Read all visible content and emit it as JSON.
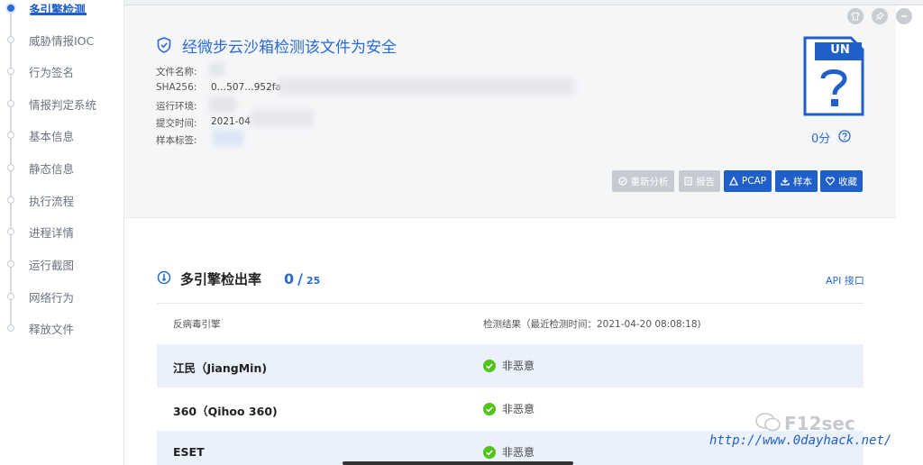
{
  "sidebar": {
    "items": [
      {
        "label": "多引擎检测",
        "active": true
      },
      {
        "label": "威胁情报IOC",
        "active": false
      },
      {
        "label": "行为签名",
        "active": false
      },
      {
        "label": "情报判定系统",
        "active": false
      },
      {
        "label": "基本信息",
        "active": false
      },
      {
        "label": "静态信息",
        "active": false
      },
      {
        "label": "执行流程",
        "active": false
      },
      {
        "label": "进程详情",
        "active": false
      },
      {
        "label": "运行截图",
        "active": false
      },
      {
        "label": "网络行为",
        "active": false
      },
      {
        "label": "释放文件",
        "active": false
      }
    ]
  },
  "header": {
    "verdict": "经微步云沙箱检测该文件为安全",
    "fields": [
      {
        "label": "文件名称:",
        "value": ""
      },
      {
        "label": "SHA256:",
        "value": "0…507…952fa"
      },
      {
        "label": "运行环境:",
        "value": ""
      },
      {
        "label": "提交时间:",
        "value": "2021-04"
      },
      {
        "label": "样本标签:",
        "value": ""
      }
    ],
    "file_type_badge": "UN",
    "score": "0分",
    "buttons": {
      "reanalyze": "重新分析",
      "report": "报告",
      "pcap": "PCAP",
      "sample": "样本",
      "favorite": "收藏"
    }
  },
  "engines": {
    "title": "多引擎检出率",
    "detected": "0",
    "separator": "/",
    "total": "25",
    "api_link": "API 接口",
    "col_engine": "反病毒引擎",
    "col_result": "检测结果（最近检测时间：2021-04-20 08:08:18)",
    "rows": [
      {
        "engine": "江民（JiangMin)",
        "result": "非恶意"
      },
      {
        "engine": "360（Qihoo 360)",
        "result": "非恶意"
      },
      {
        "engine": "ESET",
        "result": "非恶意"
      }
    ]
  },
  "watermark": {
    "brand": "F12sec",
    "url": "http://www.0dayhack.net/"
  },
  "colors": {
    "accent": "#1f5fc9",
    "safe": "#52c41a",
    "row_alt": "#eaf1fb"
  }
}
